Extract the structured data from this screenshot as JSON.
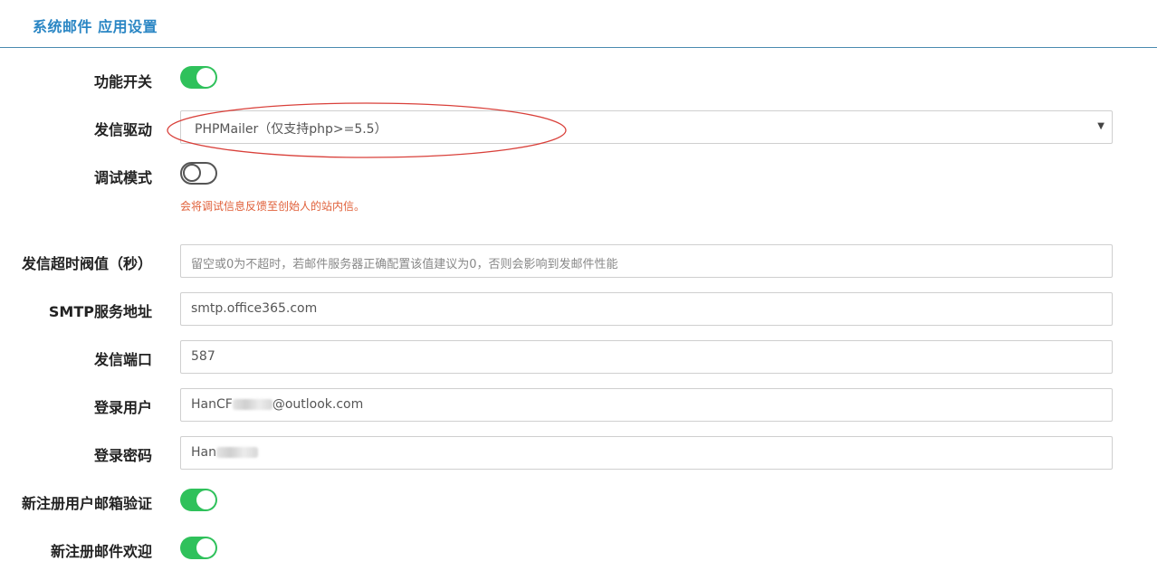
{
  "header": {
    "title": "系统邮件 应用设置"
  },
  "settings": {
    "feature_switch": {
      "label": "功能开关",
      "enabled": true
    },
    "driver": {
      "label": "发信驱动",
      "value": "PHPMailer（仅支持php>=5.5）"
    },
    "debug_mode": {
      "label": "调试模式",
      "enabled": false,
      "hint": "会将调试信息反馈至创始人的站内信。"
    },
    "timeout": {
      "label": "发信超时阀值（秒）",
      "value": "",
      "placeholder": "留空或0为不超时，若邮件服务器正确配置该值建议为0，否则会影响到发邮件性能"
    },
    "smtp_host": {
      "label": "SMTP服务地址",
      "value": "smtp.office365.com"
    },
    "port": {
      "label": "发信端口",
      "value": "587"
    },
    "username": {
      "label": "登录用户",
      "value_prefix": "HanCF",
      "value_suffix": "@outlook.com"
    },
    "password": {
      "label": "登录密码",
      "value_prefix": "Han"
    },
    "register_verify": {
      "label": "新注册用户邮箱验证",
      "enabled": true
    },
    "register_welcome": {
      "label": "新注册邮件欢迎",
      "enabled": true
    }
  },
  "colors": {
    "accent": "#2a86c4",
    "toggle_on": "#2fc15b",
    "hint": "#e0603a",
    "annotation": "#d9403a"
  }
}
